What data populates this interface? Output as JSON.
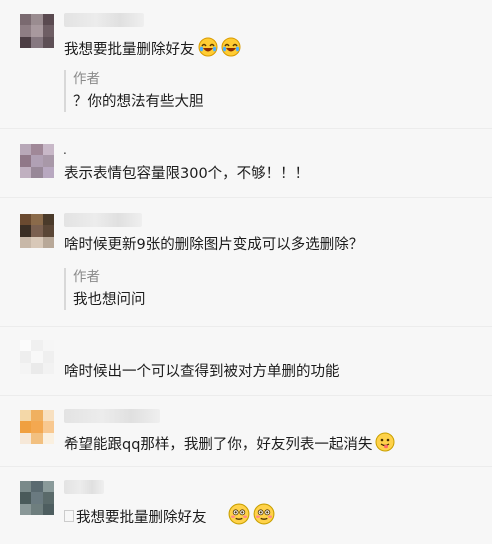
{
  "comments": [
    {
      "text": "我想要批量删除好友",
      "emojis": [
        "laugh-cry",
        "laugh-cry"
      ]
    },
    {
      "text": "表示表情包容量限300个，不够！！！",
      "emojis": [],
      "prefix": "."
    },
    {
      "text": "啥时候更新9张的删除图片变成可以多选删除？",
      "emojis": []
    },
    {
      "text": "啥时候出一个可以查得到被对方单删的功能",
      "emojis": []
    },
    {
      "text": "希望能跟qq那样，我删了你，好友列表一起消失",
      "emojis": [
        "tongue"
      ]
    },
    {
      "text": "我想要批量删除好友",
      "emojis": [
        "blush",
        "blush"
      ]
    }
  ],
  "replies": [
    {
      "author": "作者",
      "text": "？你的想法有些大胆"
    },
    {
      "author": "作者",
      "text": "我也想问问"
    }
  ]
}
